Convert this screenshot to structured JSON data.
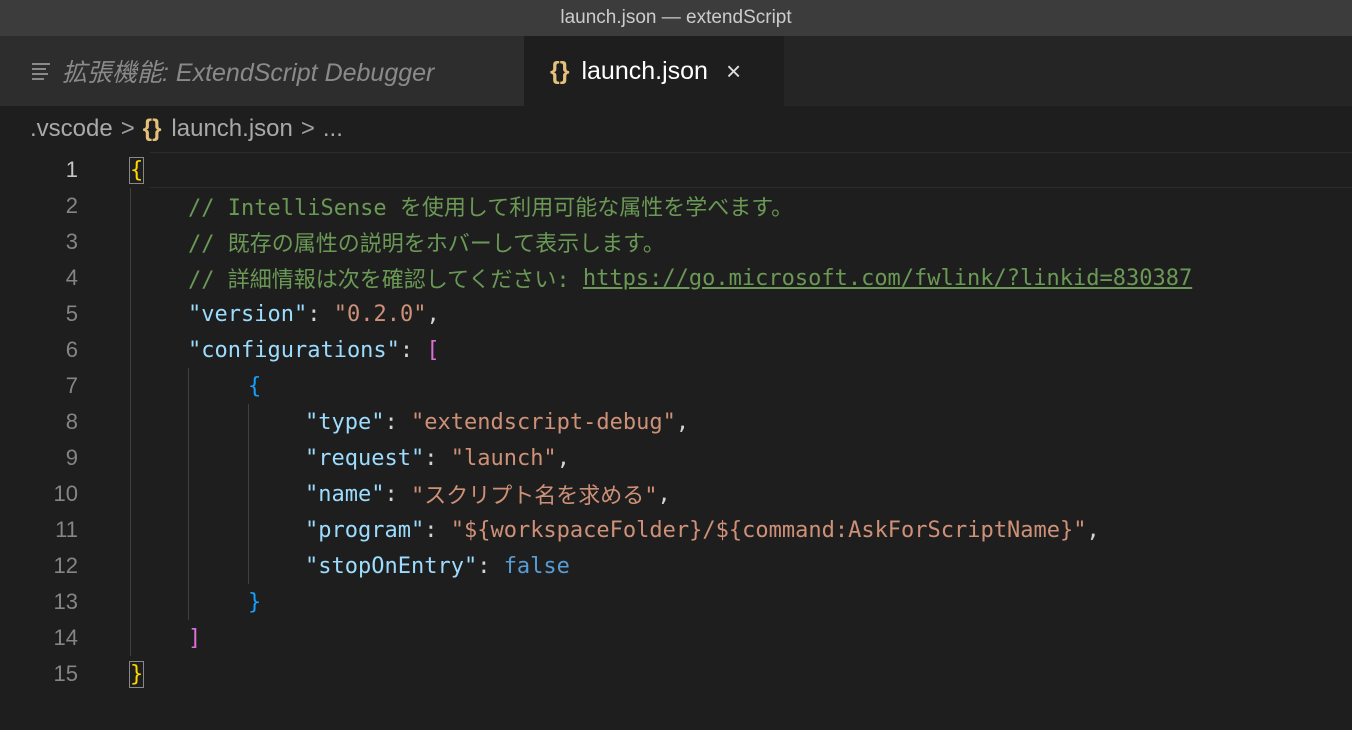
{
  "window": {
    "title": "launch.json — extendScript"
  },
  "tabs": [
    {
      "label": "拡張機能: ExtendScript Debugger",
      "icon": "preview-lines-icon",
      "active": false
    },
    {
      "label": "launch.json",
      "icon": "{}",
      "active": true,
      "close_glyph": "×"
    }
  ],
  "breadcrumb": {
    "folder": ".vscode",
    "separator": ">",
    "file_icon": "{}",
    "file": "launch.json",
    "more": "..."
  },
  "editor": {
    "line_numbers": [
      "1",
      "2",
      "3",
      "4",
      "5",
      "6",
      "7",
      "8",
      "9",
      "10",
      "11",
      "12",
      "13",
      "14",
      "15"
    ],
    "lines": {
      "l1": {
        "brace": "{"
      },
      "l2": {
        "comment": "// IntelliSense を使用して利用可能な属性を学べます。"
      },
      "l3": {
        "comment": "// 既存の属性の説明をホバーして表示します。"
      },
      "l4": {
        "comment": "// 詳細情報は次を確認してください: ",
        "link": "https://go.microsoft.com/fwlink/?linkid=830387"
      },
      "l5": {
        "key": "\"version\"",
        "colon": ": ",
        "value": "\"0.2.0\"",
        "comma": ","
      },
      "l6": {
        "key": "\"configurations\"",
        "colon": ": ",
        "bracket": "["
      },
      "l7": {
        "brace": "{"
      },
      "l8": {
        "key": "\"type\"",
        "colon": ": ",
        "value": "\"extendscript-debug\"",
        "comma": ","
      },
      "l9": {
        "key": "\"request\"",
        "colon": ": ",
        "value": "\"launch\"",
        "comma": ","
      },
      "l10": {
        "key": "\"name\"",
        "colon": ": ",
        "value": "\"スクリプト名を求める\"",
        "comma": ","
      },
      "l11": {
        "key": "\"program\"",
        "colon": ": ",
        "value": "\"${workspaceFolder}/${command:AskForScriptName}\"",
        "comma": ","
      },
      "l12": {
        "key": "\"stopOnEntry\"",
        "colon": ": ",
        "value": "false"
      },
      "l13": {
        "brace": "}"
      },
      "l14": {
        "bracket": "]"
      },
      "l15": {
        "brace": "}"
      }
    }
  },
  "colors": {
    "comment": "#6a9955",
    "key": "#9cdcfe",
    "string": "#ce9178",
    "keyword": "#569cd6",
    "brace_level1": "#ffd700",
    "bracket_level2": "#da70d6",
    "brace_level3": "#179fff"
  }
}
